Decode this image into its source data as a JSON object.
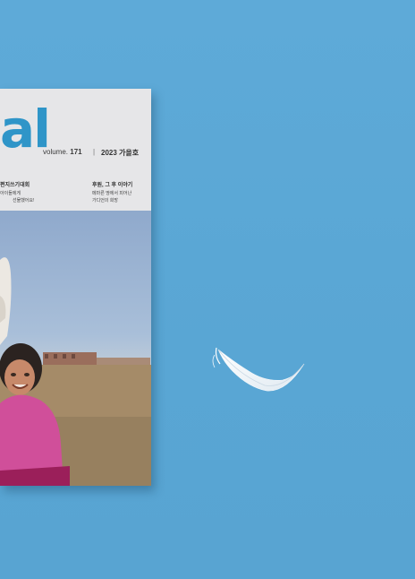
{
  "cover": {
    "masthead": "al",
    "volume_prefix": "volume.",
    "volume_number": "171",
    "separator": "|",
    "issue": "2023 가을호",
    "story_left": {
      "title": "편지쓰기대회",
      "line1": "아이들에게",
      "line2": "선물했어요!"
    },
    "story_right": {
      "title": "후원, 그 후 이야기",
      "line1": "메마른 땅에서 피어난",
      "line2": "가디언의 희망"
    }
  },
  "colors": {
    "background": "#5aa8d6",
    "masthead": "#2f95c8",
    "cover_header": "#e6e6e8"
  },
  "icons": {
    "feather": "feather-icon"
  }
}
